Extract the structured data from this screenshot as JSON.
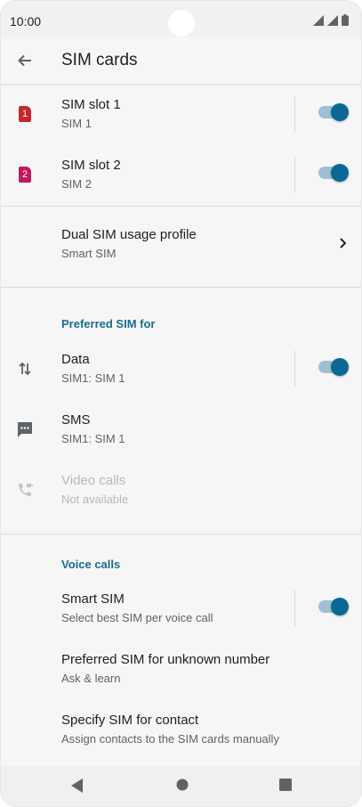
{
  "status_bar": {
    "time": "10:00"
  },
  "app_bar": {
    "title": "SIM cards"
  },
  "sim_slots": [
    {
      "label": "SIM slot 1",
      "subtitle": "SIM 1",
      "badge": "1",
      "color": "#c62828",
      "enabled": true
    },
    {
      "label": "SIM slot 2",
      "subtitle": "SIM 2",
      "badge": "2",
      "color": "#c2185b",
      "enabled": true
    }
  ],
  "dual_sim": {
    "label": "Dual SIM usage profile",
    "subtitle": "Smart SIM"
  },
  "preferred": {
    "header": "Preferred SIM for",
    "data": {
      "label": "Data",
      "subtitle": "SIM1: SIM 1",
      "enabled": true
    },
    "sms": {
      "label": "SMS",
      "subtitle": "SIM1: SIM 1"
    },
    "video": {
      "label": "Video calls",
      "subtitle": "Not available"
    }
  },
  "voice": {
    "header": "Voice calls",
    "smart_sim": {
      "label": "Smart SIM",
      "subtitle": "Select best SIM per voice call",
      "enabled": true
    },
    "unknown": {
      "label": "Preferred SIM for unknown number",
      "subtitle": "Ask & learn"
    },
    "contact": {
      "label": "Specify SIM for contact",
      "subtitle": "Assign contacts to the SIM cards manually"
    }
  },
  "colors": {
    "accent": "#0b6796",
    "section": "#1a6d8e"
  },
  "icons": [
    "back-arrow-icon",
    "swap-vert-icon",
    "sms-icon",
    "video-call-icon",
    "chevron-right-icon"
  ]
}
